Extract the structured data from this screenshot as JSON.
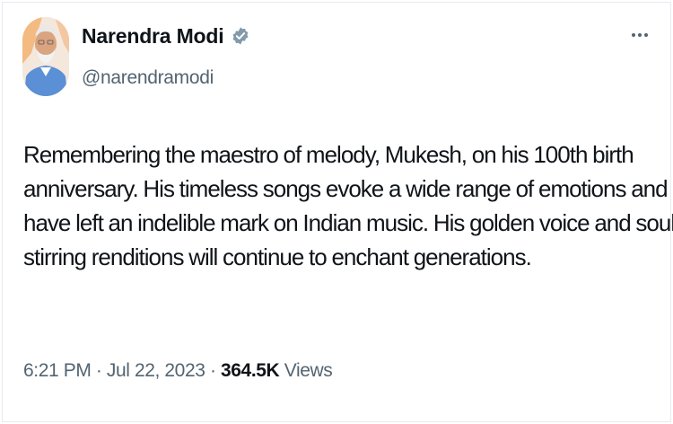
{
  "author": {
    "display_name": "Narendra Modi",
    "handle": "@narendramodi",
    "verified": true,
    "verified_color": "#829aab"
  },
  "tweet": {
    "lines": [
      "Remembering the maestro of melody, Mukesh, on his 100th birth",
      "anniversary. His timeless songs evoke a wide range of emotions and",
      "have left an indelible mark on Indian music. His golden voice and soul-",
      "stirring renditions will continue to enchant generations."
    ]
  },
  "meta": {
    "time": "6:21 PM",
    "separator": " · ",
    "date": "Jul 22, 2023",
    "views_count": "364.5K",
    "views_label": " Views"
  },
  "icons": {
    "more": "more-horizontal-icon",
    "verified": "verified-badge-icon"
  },
  "colors": {
    "text_primary": "#0f1419",
    "text_secondary": "#536471"
  }
}
